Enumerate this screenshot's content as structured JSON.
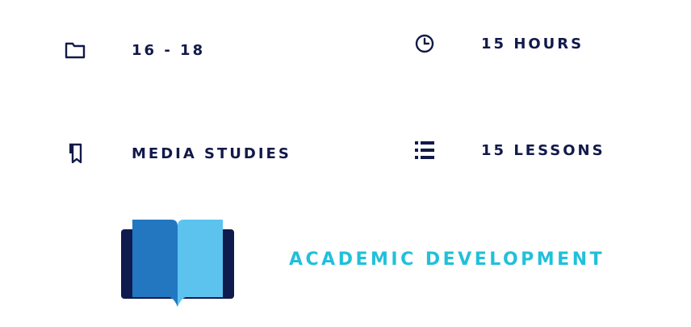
{
  "details": {
    "age_range": "16 - 18",
    "duration": "15 HOURS",
    "subject": "MEDIA STUDIES",
    "lessons": "15 LESSONS"
  },
  "icons": {
    "age_range": "folder-icon",
    "duration": "clock-icon",
    "subject": "bookmark-book-icon",
    "lessons": "list-icon",
    "category": "open-book-icon"
  },
  "category": {
    "title": "ACADEMIC DEVELOPMENT"
  },
  "colors": {
    "text_dark": "#12194a",
    "accent_cyan": "#21c0da",
    "book_dark": "#0f1b4d",
    "book_left": "#2277c0",
    "book_right": "#5bc3ee"
  }
}
